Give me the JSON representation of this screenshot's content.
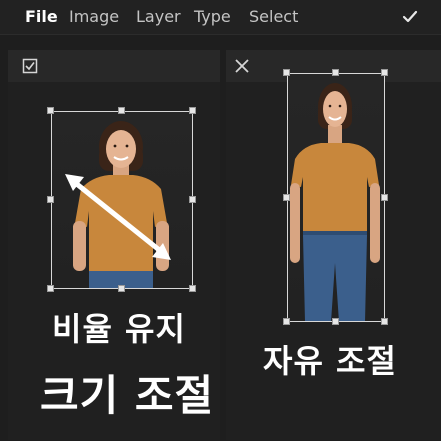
{
  "menu": {
    "items": [
      "File",
      "Image",
      "Layer",
      "Type",
      "Select"
    ],
    "confirm_icon": "checkmark-icon"
  },
  "left_panel": {
    "header_icon": "checkbox-checked-icon",
    "caption_line1": "비율 유지",
    "caption_line2": "크기 조절"
  },
  "right_panel": {
    "header_icon": "close-x-icon",
    "caption": "자유 조절"
  },
  "colors": {
    "background": "#1e1e1e",
    "menubar": "#222222",
    "panel_header": "#282828",
    "shirt": "#c8873c",
    "jeans": "#3b5f8c",
    "arrow": "#ffffff"
  }
}
